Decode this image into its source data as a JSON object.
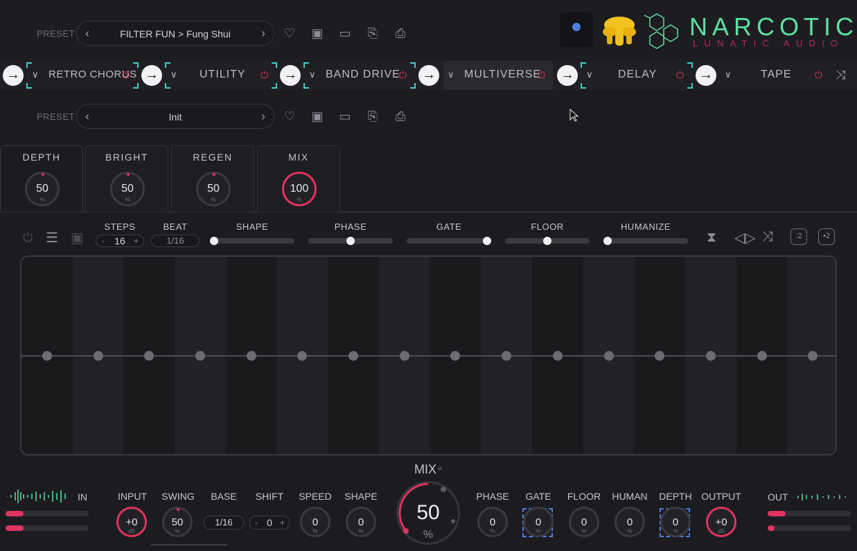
{
  "colors": {
    "accent": "#e0335f",
    "brand": "#5de0a3",
    "select": "#42d0c7",
    "rec": "#4d7fe0"
  },
  "top_preset": {
    "label": "PRESET",
    "value": "FILTER FUN > Fung Shui"
  },
  "module_preset": {
    "label": "PRESET",
    "value": "Init"
  },
  "brand": {
    "name": "NARCOTIC",
    "sub": "LUNATIC AUDIO"
  },
  "modules": [
    {
      "name": "RETRO CHORUS",
      "selected": true
    },
    {
      "name": "UTILITY",
      "selected": true
    },
    {
      "name": "BAND DRIVE",
      "selected": true
    },
    {
      "name": "MULTIVERSE",
      "selected": false,
      "active": true
    },
    {
      "name": "DELAY",
      "selected": true
    },
    {
      "name": "TAPE",
      "selected": false
    }
  ],
  "tabs": [
    {
      "label": "DEPTH",
      "value": "50",
      "unit": "%"
    },
    {
      "label": "BRIGHT",
      "value": "50",
      "unit": "%"
    },
    {
      "label": "REGEN",
      "value": "50",
      "unit": "%"
    },
    {
      "label": "MIX",
      "value": "100",
      "unit": "%"
    }
  ],
  "sequencer": {
    "steps_label": "STEPS",
    "steps": "16",
    "minus": "-",
    "plus": "+",
    "beat_label": "BEAT",
    "beat": "1/16",
    "sliders": [
      {
        "label": "SHAPE",
        "level": 0.0
      },
      {
        "label": "PHASE",
        "level": 0.5
      },
      {
        "label": "GATE",
        "level": 1.0
      },
      {
        "label": "FLOOR",
        "level": 0.5
      },
      {
        "label": "HUMANIZE",
        "level": 0.0
      }
    ],
    "step_count": 16,
    "step_values": [
      0.5,
      0.5,
      0.5,
      0.5,
      0.5,
      0.5,
      0.5,
      0.5,
      0.5,
      0.5,
      0.5,
      0.5,
      0.5,
      0.5,
      0.5,
      0.5
    ],
    "tool_half": ":2",
    "tool_double": "•2"
  },
  "bottom": {
    "in_label": "IN",
    "out_label": "OUT",
    "in_meter": [
      0.22,
      0.22
    ],
    "out_meter": [
      0.22,
      0.08
    ],
    "input": {
      "label": "INPUT",
      "value": "+0",
      "unit": "dB"
    },
    "swing": {
      "label": "SWING",
      "value": "50",
      "unit": "%"
    },
    "base": {
      "label": "BASE",
      "value": "1/16"
    },
    "shift": {
      "label": "SHIFT",
      "value": "0",
      "minus": "-",
      "plus": "+"
    },
    "speed": {
      "label": "SPEED",
      "value": "0",
      "unit": "%"
    },
    "shape": {
      "label": "SHAPE",
      "value": "0",
      "unit": "%"
    },
    "mix": {
      "label": "MIX",
      "value": "50",
      "unit": "%"
    },
    "phase": {
      "label": "PHASE",
      "value": "0",
      "unit": "%"
    },
    "gate": {
      "label": "GATE",
      "value": "0",
      "unit": "%"
    },
    "floor": {
      "label": "FLOOR",
      "value": "0",
      "unit": "%"
    },
    "human": {
      "label": "HUMAN",
      "value": "0",
      "unit": "%"
    },
    "depth": {
      "label": "DEPTH",
      "value": "0",
      "unit": "%"
    },
    "output": {
      "label": "OUTPUT",
      "value": "+0",
      "unit": "dB"
    }
  }
}
